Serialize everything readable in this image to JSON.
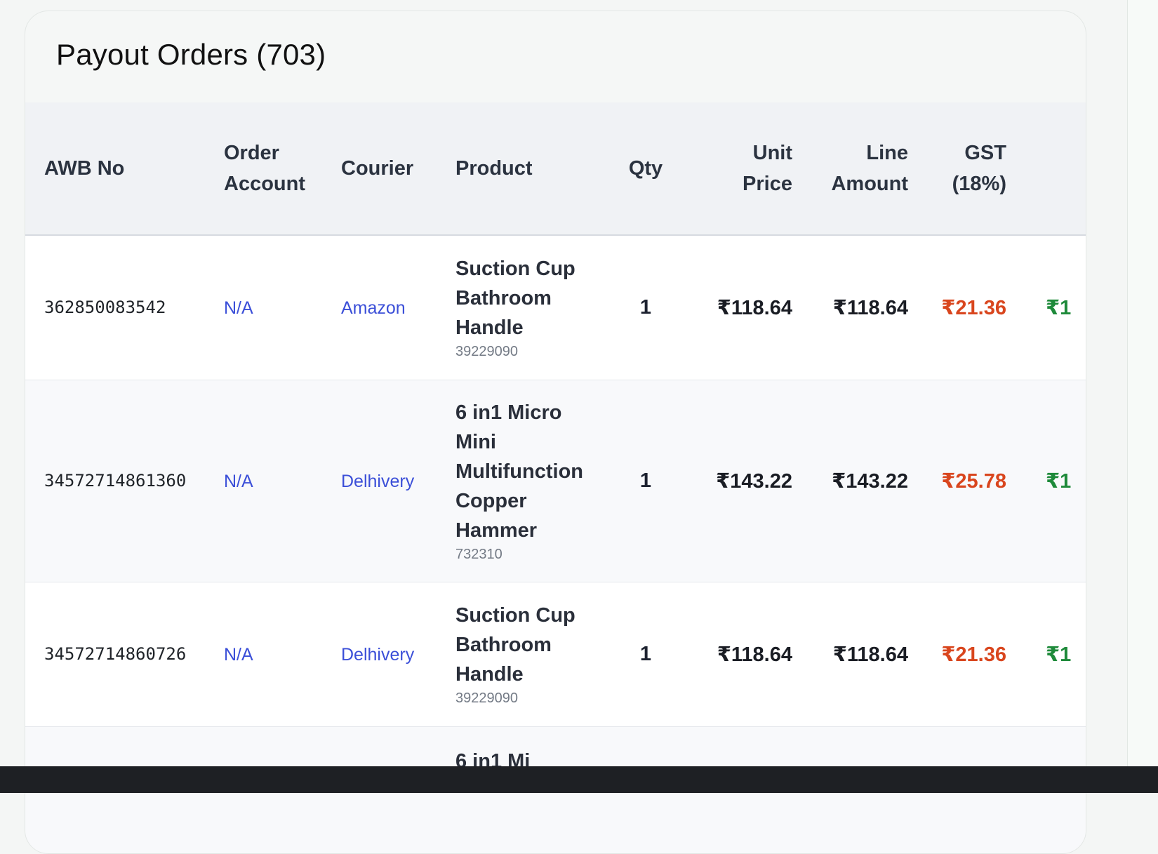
{
  "card": {
    "title": "Payout Orders (703)"
  },
  "table": {
    "headers": {
      "awb": "AWB No",
      "order_account_1": "Order",
      "order_account_2": "Account",
      "courier": "Courier",
      "product": "Product",
      "qty": "Qty",
      "unit_price_1": "Unit",
      "unit_price_2": "Price",
      "line_amount_1": "Line",
      "line_amount_2": "Amount",
      "gst_1": "GST",
      "gst_2": "(18%)"
    },
    "rows": [
      {
        "awb": "362850083542",
        "order_account": "N/A",
        "courier": "Amazon",
        "product_lines": [
          "Suction Cup",
          "Bathroom",
          "Handle"
        ],
        "hsn": "39229090",
        "qty": "1",
        "unit_price": "₹118.64",
        "line_amount": "₹118.64",
        "gst": "₹21.36",
        "net_partial": "₹1"
      },
      {
        "awb": "34572714861360",
        "order_account": "N/A",
        "courier": "Delhivery",
        "product_lines": [
          "6 in1 Micro",
          "Mini",
          "Multifunction",
          "Copper",
          "Hammer"
        ],
        "hsn": "732310",
        "qty": "1",
        "unit_price": "₹143.22",
        "line_amount": "₹143.22",
        "gst": "₹25.78",
        "net_partial": "₹1"
      },
      {
        "awb": "34572714860726",
        "order_account": "N/A",
        "courier": "Delhivery",
        "product_lines": [
          "Suction Cup",
          "Bathroom",
          "Handle"
        ],
        "hsn": "39229090",
        "qty": "1",
        "unit_price": "₹118.64",
        "line_amount": "₹118.64",
        "gst": "₹21.36",
        "net_partial": "₹1"
      },
      {
        "awb": "",
        "order_account": "",
        "courier": "",
        "product_lines": [
          "6 in1 Mi"
        ],
        "hsn": "",
        "qty": "",
        "unit_price": "",
        "line_amount": "",
        "gst": "",
        "net_partial": ""
      }
    ]
  },
  "colors": {
    "link": "#3b4fd8",
    "gst": "#d9461e",
    "net": "#1e8a3a"
  }
}
